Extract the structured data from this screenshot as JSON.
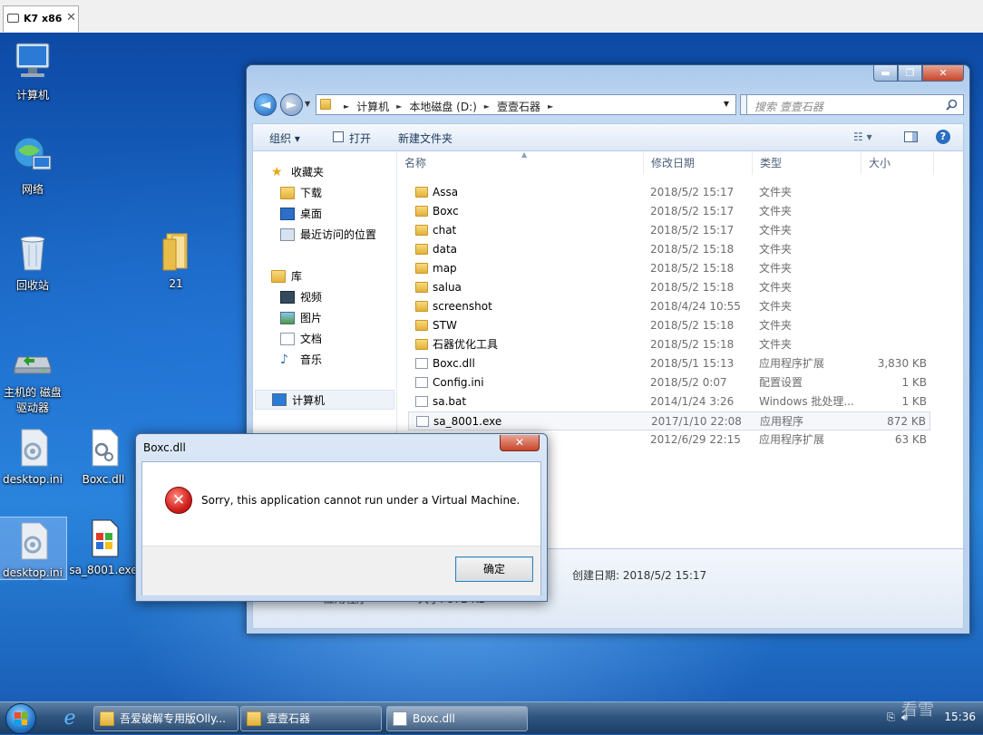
{
  "vm_tab": {
    "label": "K7 x86",
    "close": "✕"
  },
  "desktop_icons": [
    {
      "label": "计算机"
    },
    {
      "label": "网络"
    },
    {
      "label": "回收站"
    },
    {
      "label": "21"
    },
    {
      "label": "主机的 磁盘\n驱动器"
    },
    {
      "label": "desktop.ini"
    },
    {
      "label": "Boxc.dll"
    },
    {
      "label": "desktop.ini"
    },
    {
      "label": "sa_8001.exe"
    }
  ],
  "explorer": {
    "caption": {
      "minimize": "▬",
      "maximize": "❐",
      "close": "✕"
    },
    "back": "◄",
    "forward": "►",
    "address": [
      "计算机",
      "本地磁盘 (D:)",
      "壹壹石器"
    ],
    "refresh": "↻",
    "search_placeholder": "搜索 壹壹石器",
    "toolbar": {
      "organize": "组织 ▾",
      "open": "打开",
      "new_folder": "新建文件夹"
    },
    "nav": {
      "favorites": "收藏夹",
      "downloads": "下载",
      "desktop": "桌面",
      "recent": "最近访问的位置",
      "libraries": "库",
      "videos": "视频",
      "pictures": "图片",
      "documents": "文档",
      "music": "音乐",
      "computer": "计算机"
    },
    "columns": {
      "name": "名称",
      "date": "修改日期",
      "type": "类型",
      "size": "大小"
    },
    "files": [
      {
        "name": "Assa",
        "date": "2018/5/2 15:17",
        "type": "文件夹",
        "size": "",
        "kind": "folder"
      },
      {
        "name": "Boxc",
        "date": "2018/5/2 15:17",
        "type": "文件夹",
        "size": "",
        "kind": "folder"
      },
      {
        "name": "chat",
        "date": "2018/5/2 15:17",
        "type": "文件夹",
        "size": "",
        "kind": "folder"
      },
      {
        "name": "data",
        "date": "2018/5/2 15:18",
        "type": "文件夹",
        "size": "",
        "kind": "folder"
      },
      {
        "name": "map",
        "date": "2018/5/2 15:18",
        "type": "文件夹",
        "size": "",
        "kind": "folder"
      },
      {
        "name": "salua",
        "date": "2018/5/2 15:18",
        "type": "文件夹",
        "size": "",
        "kind": "folder"
      },
      {
        "name": "screenshot",
        "date": "2018/4/24 10:55",
        "type": "文件夹",
        "size": "",
        "kind": "folder"
      },
      {
        "name": "STW",
        "date": "2018/5/2 15:18",
        "type": "文件夹",
        "size": "",
        "kind": "folder"
      },
      {
        "name": "石器优化工具",
        "date": "2018/5/2 15:18",
        "type": "文件夹",
        "size": "",
        "kind": "folder"
      },
      {
        "name": "Boxc.dll",
        "date": "2018/5/1 15:13",
        "type": "应用程序扩展",
        "size": "3,830 KB",
        "kind": "file"
      },
      {
        "name": "Config.ini",
        "date": "2018/5/2 0:07",
        "type": "配置设置",
        "size": "1 KB",
        "kind": "file"
      },
      {
        "name": "sa.bat",
        "date": "2014/1/24 3:26",
        "type": "Windows 批处理...",
        "size": "1 KB",
        "kind": "file"
      },
      {
        "name": "sa_8001.exe",
        "date": "2017/1/10 22:08",
        "type": "应用程序",
        "size": "872 KB",
        "kind": "exe"
      },
      {
        "name": "",
        "date": "2012/6/29 22:15",
        "type": "应用程序扩展",
        "size": "63 KB",
        "kind": "file"
      }
    ],
    "details": {
      "type": "应用程序",
      "created": "创建日期: 2018/5/2 15:17",
      "size": "大小: 872 KB"
    }
  },
  "dialog": {
    "title": "Boxc.dll",
    "close": "✕",
    "message": "Sorry, this application cannot run under a Virtual Machine.",
    "ok": "确定",
    "icon": "error-icon"
  },
  "taskbar": {
    "tasks": [
      "吾爱破解专用版Olly...",
      "壹壹石器",
      "Boxc.dll"
    ],
    "clock": "15:36",
    "watermark": "看雪"
  },
  "colors": {
    "accent": "#1d6fcc",
    "error": "#d0201c",
    "close": "#c7452b"
  }
}
